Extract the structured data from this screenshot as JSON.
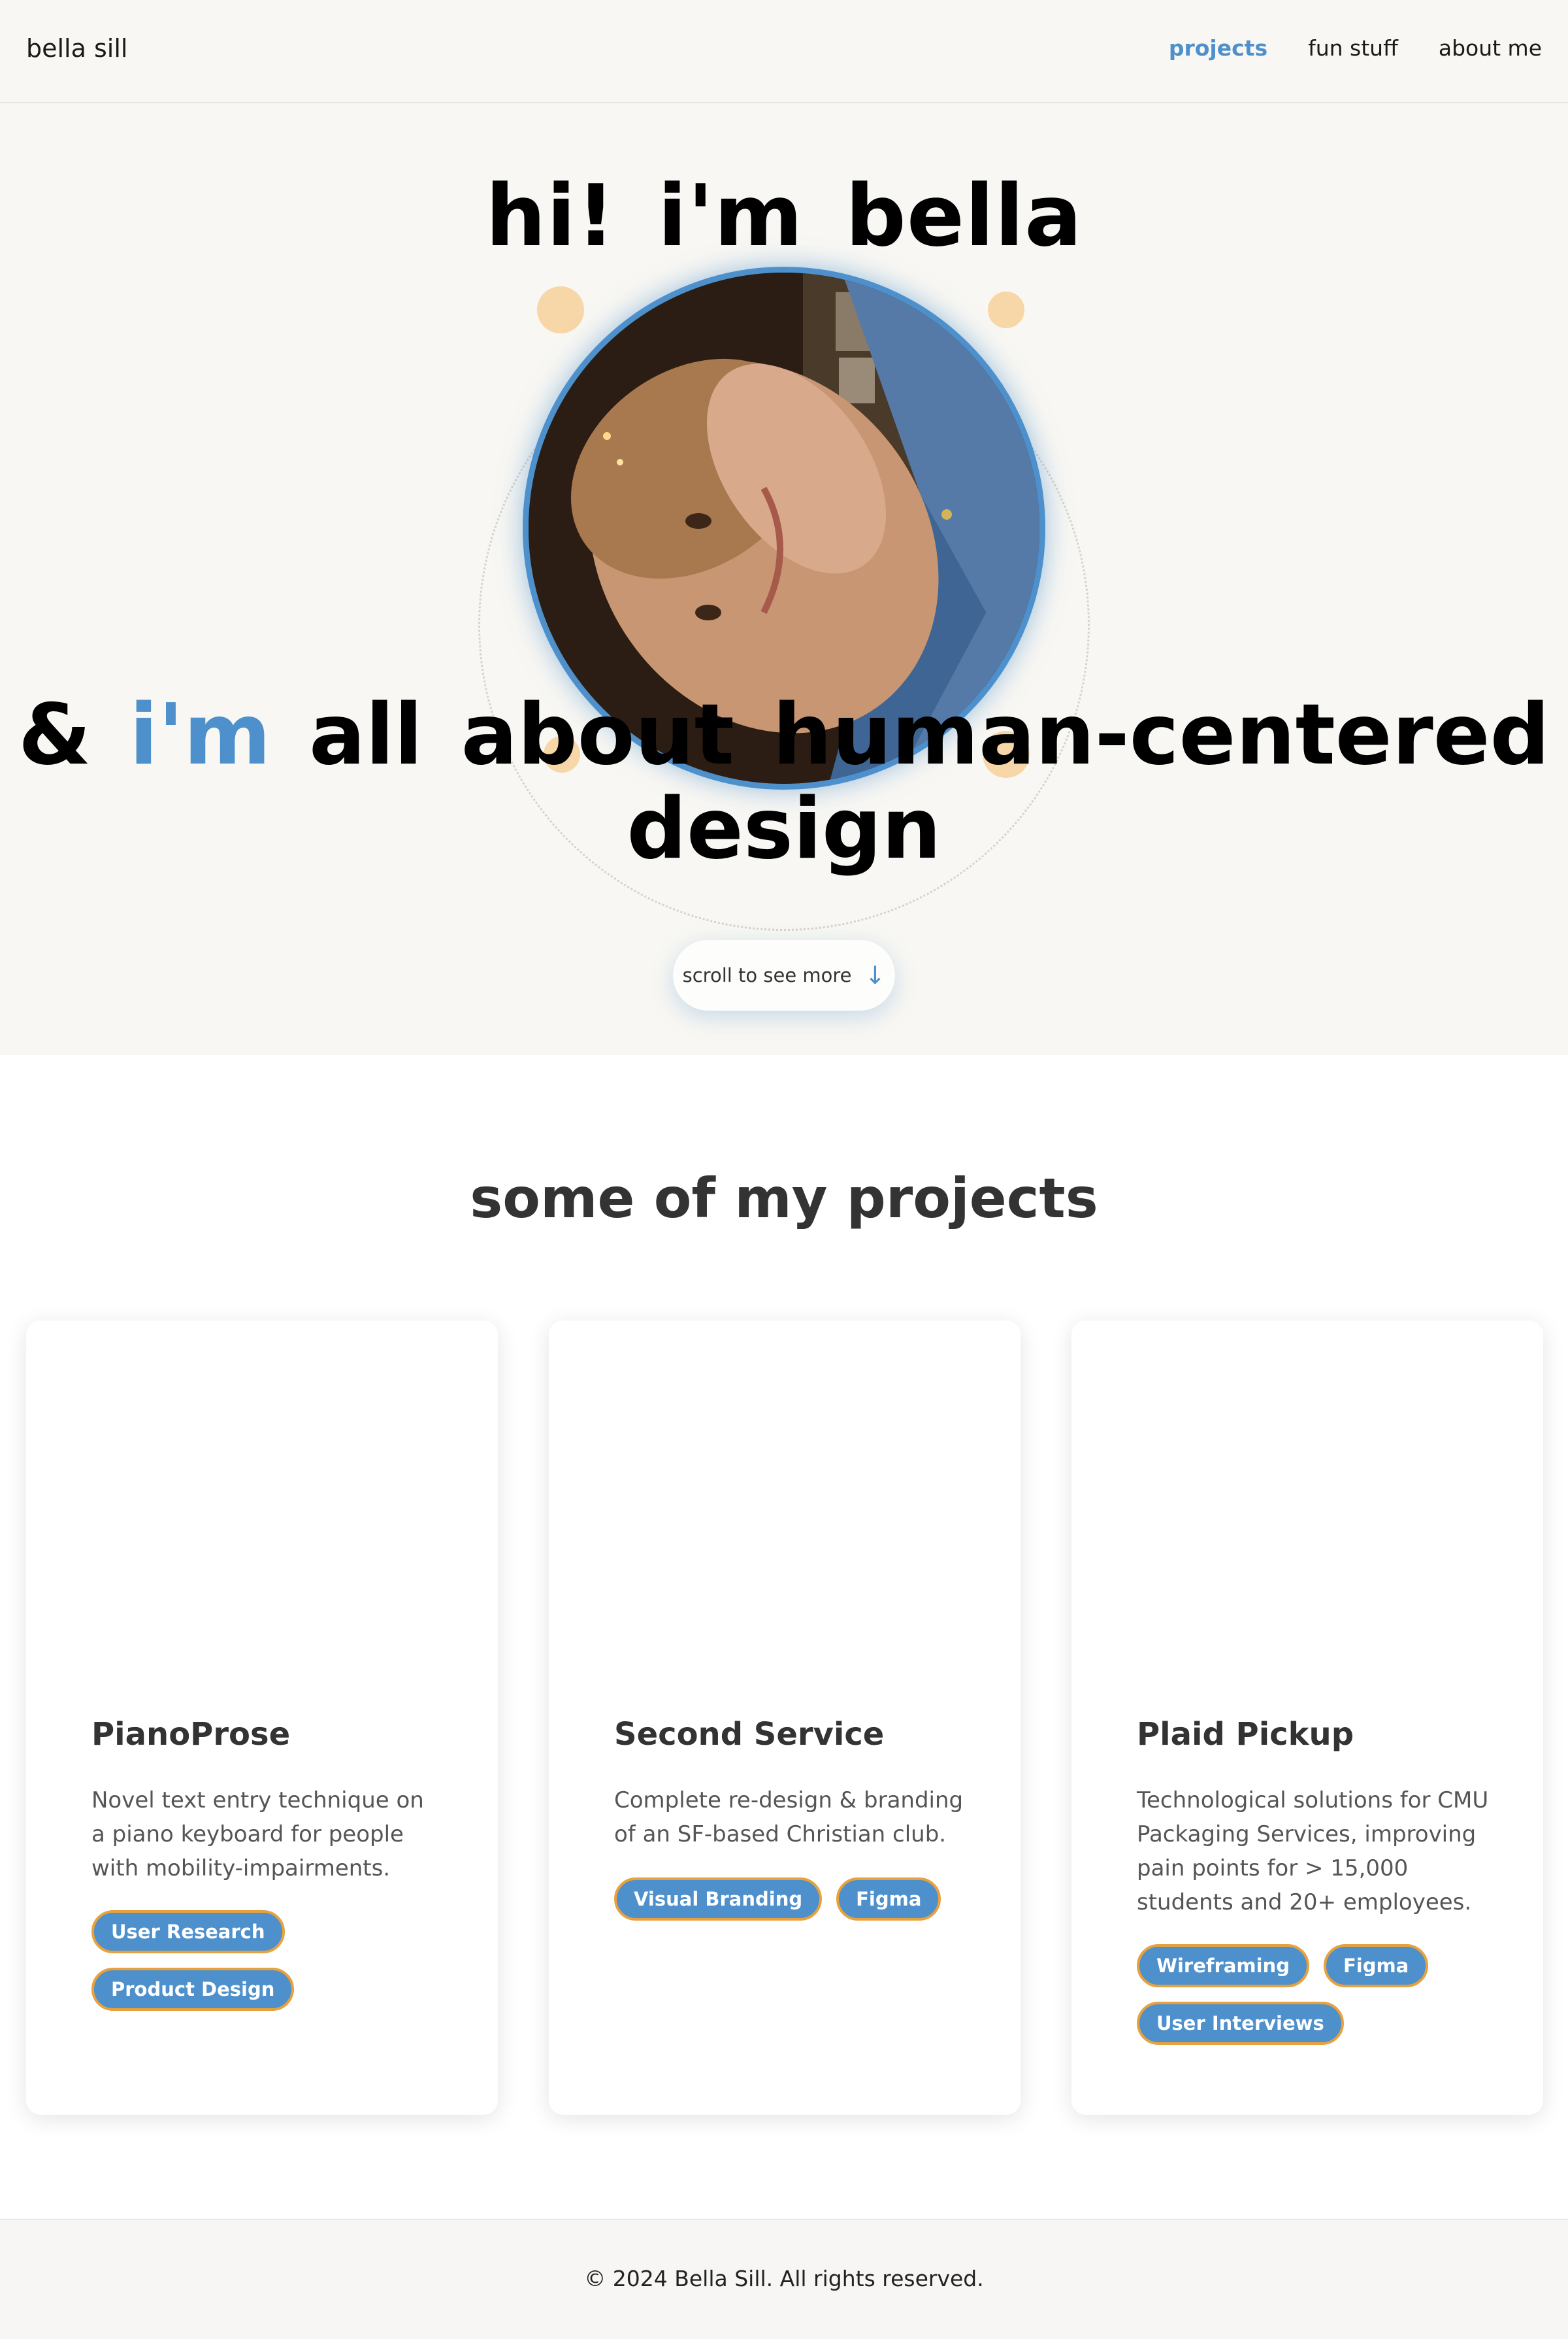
{
  "nav": {
    "brand": "bella sill",
    "links": [
      "projects",
      "fun stuff",
      "about me"
    ],
    "active": "projects"
  },
  "hero": {
    "title": "hi! i'm bella",
    "subtitle_start": "& ",
    "subtitle_accent": "i'm",
    "subtitle_end": " all about human-centered design",
    "scroll_label": "scroll to see more",
    "scroll_icon": "arrow-down-icon",
    "portrait_alt": "portrait-photo"
  },
  "projects": {
    "title": "some of my projects",
    "cards": [
      {
        "title": "PianoProse",
        "description": "Novel text entry technique on a piano keyboard for people with mobility-impairments.",
        "tags": [
          "User Research",
          "Product Design"
        ]
      },
      {
        "title": "Second Service",
        "description": "Complete re-design & branding of an SF-based Christian club.",
        "tags": [
          "Visual Branding",
          "Figma"
        ]
      },
      {
        "title": "Plaid Pickup",
        "description": "Technological solutions for CMU Packaging Services, improving pain points for > 15,000 students and 20+ employees.",
        "tags": [
          "Wireframing",
          "Figma",
          "User Interviews"
        ]
      }
    ]
  },
  "footer": {
    "text": "© 2024 Bella Sill. All rights reserved."
  },
  "colors": {
    "accent": "#4d90cc",
    "tag_border": "#e7a13d",
    "hero_bg": "#f8f7f3"
  }
}
